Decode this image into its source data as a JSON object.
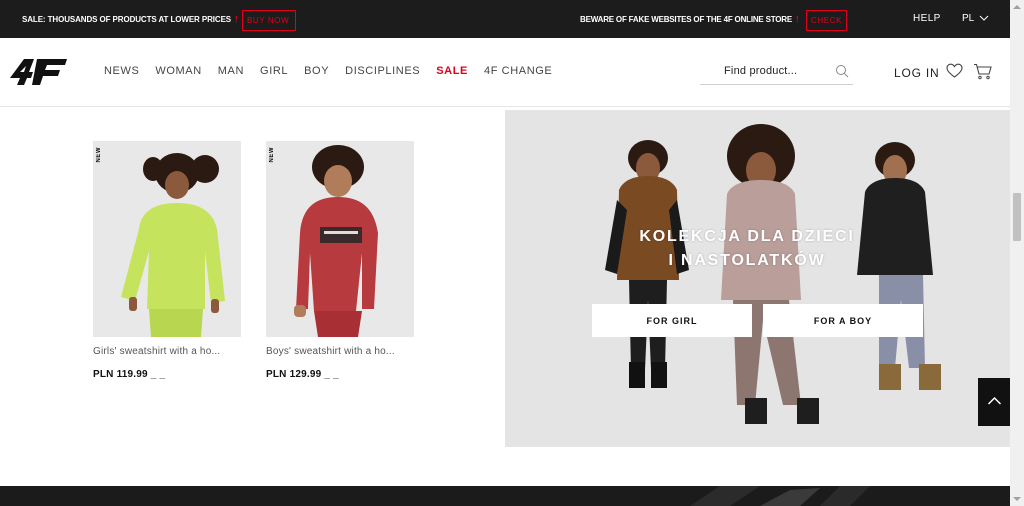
{
  "topbar": {
    "sale_text": "SALE: THOUSANDS OF PRODUCTS AT LOWER PRICES",
    "exclamation": "!",
    "buy_now": "BUY NOW",
    "fake_text": "BEWARE OF FAKE WEBSITES OF THE 4F ONLINE STORE",
    "check": "CHECK",
    "help": "HELP",
    "lang": "PL"
  },
  "header": {
    "logo_text": "4F",
    "nav": [
      "NEWS",
      "WOMAN",
      "MAN",
      "GIRL",
      "BOY",
      "DISCIPLINES",
      "SALE",
      "4F CHANGE"
    ],
    "search_placeholder": "Find product...",
    "login": "LOG IN"
  },
  "products": [
    {
      "badge": "NEW",
      "name": "Girls' sweatshirt with a ho...",
      "price": "PLN 119.99 _ _"
    },
    {
      "badge": "NEW",
      "name": "Boys' sweatshirt with a ho...",
      "price": "PLN 129.99 _ _"
    }
  ],
  "banner": {
    "title_line1": "KOLEKCJA DLA DZIECI",
    "title_line2": "I NASTOLATKÓW",
    "for_girl": "FOR GIRL",
    "for_boy": "FOR A BOY"
  },
  "colors": {
    "accent_red": "#e1001a",
    "dark": "#1c1c1c"
  }
}
